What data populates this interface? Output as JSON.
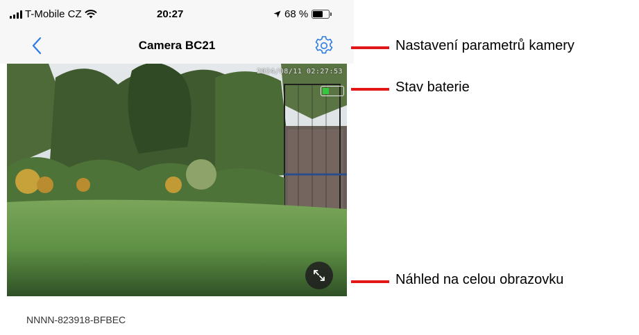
{
  "status_bar": {
    "carrier": "T-Mobile CZ",
    "time": "20:27",
    "battery_percent": "68 %",
    "battery_level": 0.68
  },
  "nav": {
    "title": "Camera BC21",
    "back_icon": "chevron-left-icon",
    "settings_icon": "gear-icon"
  },
  "video": {
    "timestamp": "2024/08/11 02:27:53",
    "camera_battery_level": 0.35,
    "fullscreen_icon": "expand-icon"
  },
  "device_id": "NNNN-823918-BFBEC",
  "annotations": [
    {
      "text": "Nastavení parametrů kamery"
    },
    {
      "text": "Stav baterie"
    },
    {
      "text": "Náhled na celou obrazovku"
    }
  ],
  "colors": {
    "accent": "#2c7be5",
    "callout": "#e21616",
    "battery_green": "#36c73f"
  }
}
